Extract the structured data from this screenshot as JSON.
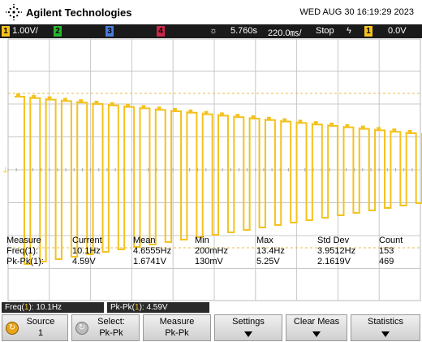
{
  "header": {
    "brand": "Agilent Technologies",
    "datetime": "WED AUG 30 16:19:29 2023"
  },
  "status": {
    "ch1_num": "1",
    "ch1_scale": "1.00V/",
    "ch2_num": "2",
    "ch3_num": "3",
    "ch4_num": "4",
    "sun_icon": "☼",
    "time_offset": "5.760s",
    "time_scale": "220.0㎳/",
    "run_state": "Stop",
    "trig_icon": "ϟ",
    "trig_ch": "1",
    "trig_level": "0.0V"
  },
  "waveform": {
    "color": "#f4c21f",
    "signal": "square wave with decaying amplitude"
  },
  "measurements": {
    "headers": [
      "Measure",
      "Current",
      "Mean",
      "Min",
      "Max",
      "Std Dev",
      "Count"
    ],
    "rows": [
      {
        "name": "Freq(1):",
        "current": "10.1Hz",
        "mean": "4.6555Hz",
        "min": "200mHz",
        "max": "13.4Hz",
        "stddev": "3.9512Hz",
        "count": "153"
      },
      {
        "name": "Pk-Pk(1):",
        "current": "4.59V",
        "mean": "1.6741V",
        "min": "130mV",
        "max": "5.25V",
        "stddev": "2.1619V",
        "count": "469"
      }
    ]
  },
  "readout": {
    "freq_label": "Freq(",
    "freq_ch": "1",
    "freq_value": "): 10.1Hz",
    "pk_label": "Pk-Pk(",
    "pk_ch": "1",
    "pk_value": "): 4.59V"
  },
  "softkeys": {
    "source_l1": "Source",
    "source_l2": "1",
    "select_l1": "Select:",
    "select_l2": "Pk-Pk",
    "measure_l1": "Measure",
    "measure_l2": "Pk-Pk",
    "settings": "Settings",
    "clear_meas": "Clear Meas",
    "statistics": "Statistics"
  }
}
